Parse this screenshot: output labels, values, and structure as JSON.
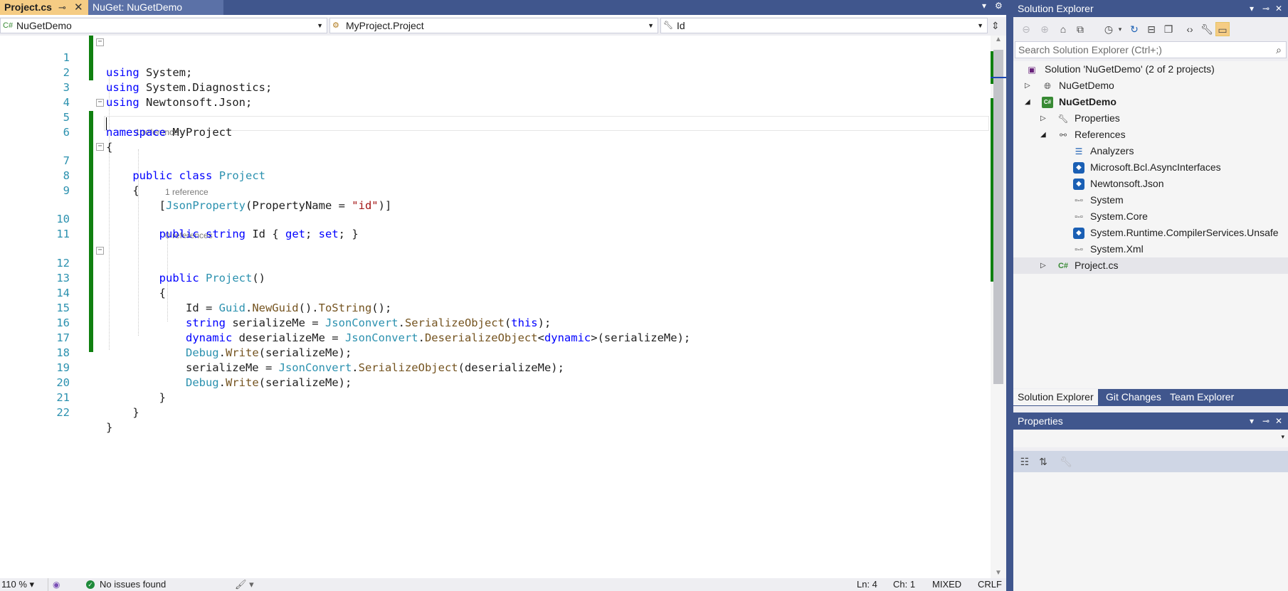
{
  "document_tabs": [
    {
      "label": "Project.cs",
      "active": true
    },
    {
      "label": "NuGet: NuGetDemo",
      "active": false
    }
  ],
  "navigation": {
    "project": "NuGetDemo",
    "type": "MyProject.Project",
    "member": "Id"
  },
  "code": {
    "lines": [
      {
        "n": "1",
        "text": "using System;"
      },
      {
        "n": "2",
        "text": "using System.Diagnostics;"
      },
      {
        "n": "3",
        "text": "using Newtonsoft.Json;"
      },
      {
        "n": "4",
        "text": ""
      },
      {
        "n": "5",
        "text": "namespace MyProject"
      },
      {
        "n": "6",
        "text": "{"
      },
      {
        "n": "7",
        "text": "    public class Project"
      },
      {
        "n": "8",
        "text": "    {"
      },
      {
        "n": "9",
        "text": "        [JsonProperty(PropertyName = \"id\")]"
      },
      {
        "n": "10",
        "text": "        public string Id { get; set; }"
      },
      {
        "n": "11",
        "text": ""
      },
      {
        "n": "12",
        "text": "        public Project()"
      },
      {
        "n": "13",
        "text": "        {"
      },
      {
        "n": "14",
        "text": "            Id = Guid.NewGuid().ToString();"
      },
      {
        "n": "15",
        "text": "            string serializeMe = JsonConvert.SerializeObject(this);"
      },
      {
        "n": "16",
        "text": "            dynamic deserializeMe = JsonConvert.DeserializeObject<dynamic>(serializeMe);"
      },
      {
        "n": "17",
        "text": "            Debug.Write(serializeMe);"
      },
      {
        "n": "18",
        "text": "            serializeMe = JsonConvert.SerializeObject(deserializeMe);"
      },
      {
        "n": "19",
        "text": "            Debug.Write(serializeMe);"
      },
      {
        "n": "20",
        "text": "        }"
      },
      {
        "n": "21",
        "text": "    }"
      },
      {
        "n": "22",
        "text": "}"
      }
    ],
    "codelens": {
      "class": "1 reference",
      "property": "1 reference",
      "constructor": "0 references"
    }
  },
  "status_bar": {
    "zoom": "110 %",
    "issues": "No issues found",
    "line": "Ln: 4",
    "column": "Ch: 1",
    "tabs_mode": "MIXED",
    "line_endings": "CRLF"
  },
  "solution_explorer": {
    "title": "Solution Explorer",
    "search_placeholder": "Search Solution Explorer (Ctrl+;)",
    "tree": [
      {
        "label": "Solution 'NuGetDemo' (2 of 2 projects)",
        "icon": "solution-icon",
        "depth": 0,
        "expander": "none"
      },
      {
        "label": "NuGetDemo",
        "icon": "web-project-icon",
        "depth": 0,
        "expander": "collapsed"
      },
      {
        "label": "NuGetDemo",
        "icon": "csharp-project-icon",
        "depth": 0,
        "expander": "expanded",
        "bold": true
      },
      {
        "label": "Properties",
        "icon": "wrench-icon",
        "depth": 1,
        "expander": "collapsed"
      },
      {
        "label": "References",
        "icon": "references-icon",
        "depth": 1,
        "expander": "expanded"
      },
      {
        "label": "Analyzers",
        "icon": "analyzer-icon",
        "depth": 2,
        "expander": "none"
      },
      {
        "label": "Microsoft.Bcl.AsyncInterfaces",
        "icon": "nuget-package-icon",
        "depth": 2,
        "expander": "none"
      },
      {
        "label": "Newtonsoft.Json",
        "icon": "nuget-package-icon",
        "depth": 2,
        "expander": "none"
      },
      {
        "label": "System",
        "icon": "assembly-icon",
        "depth": 2,
        "expander": "none"
      },
      {
        "label": "System.Core",
        "icon": "assembly-icon",
        "depth": 2,
        "expander": "none"
      },
      {
        "label": "System.Runtime.CompilerServices.Unsafe",
        "icon": "nuget-package-icon",
        "depth": 2,
        "expander": "none"
      },
      {
        "label": "System.Xml",
        "icon": "assembly-icon",
        "depth": 2,
        "expander": "none"
      },
      {
        "label": "Project.cs",
        "icon": "csharp-file-icon",
        "depth": 1,
        "expander": "collapsed",
        "selected": true
      }
    ],
    "bottom_tabs": [
      {
        "label": "Solution Explorer",
        "active": true
      },
      {
        "label": "Git Changes",
        "active": false
      },
      {
        "label": "Team Explorer",
        "active": false
      }
    ]
  },
  "properties": {
    "title": "Properties"
  },
  "colors": {
    "title_bar": "#40568d",
    "active_tab": "#f5cc84",
    "change_bar": "#108010",
    "keyword": "#0000ff",
    "type": "#2b91af",
    "method": "#74531f",
    "string": "#a31515"
  }
}
